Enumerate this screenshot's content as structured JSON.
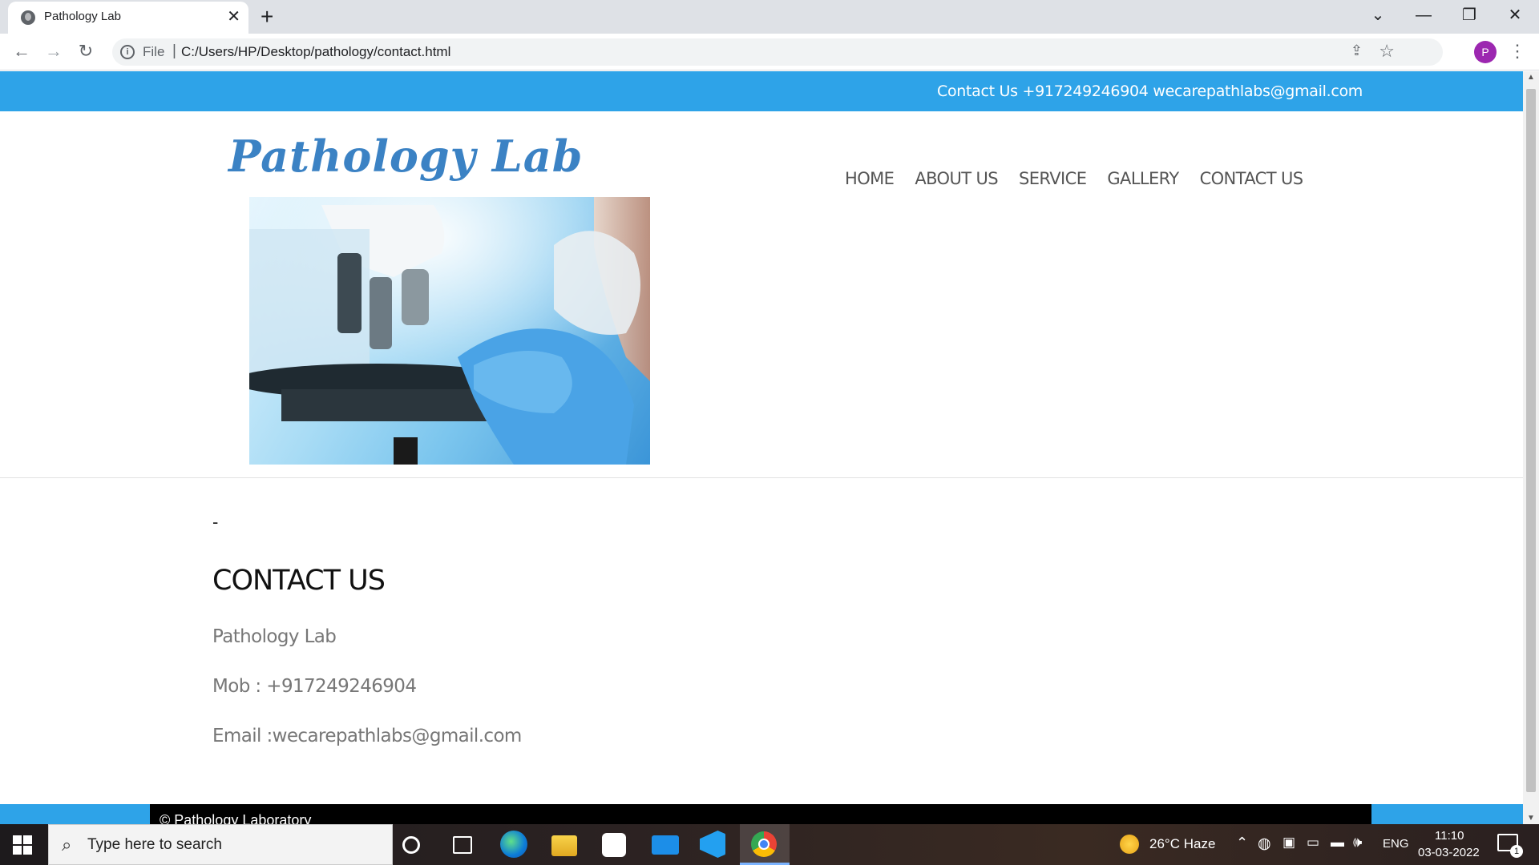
{
  "browser": {
    "tab_title": "Pathology Lab",
    "tab_close": "✕",
    "new_tab": "+",
    "window_controls": {
      "chevron": "⌄",
      "minimize": "—",
      "restore": "❐",
      "close": "✕"
    },
    "nav": {
      "back": "←",
      "forward": "→",
      "reload": "↻"
    },
    "omnibox": {
      "info": "i",
      "scheme_label": "File",
      "separator": "|",
      "url": "C:/Users/HP/Desktop/pathology/contact.html"
    },
    "share_icon": "⇪",
    "star_icon": "☆",
    "profile_initial": "P",
    "menu_icon": "⋮"
  },
  "page": {
    "topbar_text": "Contact Us +917249246904 wecarepathlabs@gmail.com",
    "logo": "Pathology Lab",
    "nav": [
      "HOME",
      "ABOUT US",
      "SERVICE",
      "GALLERY",
      "CONTACT US"
    ],
    "dash": "-",
    "heading": "CONTACT US",
    "lines": [
      "Pathology Lab",
      "Mob : +917249246904",
      "Email :wecarepathlabs@gmail.com"
    ],
    "footer": "© Pathology Laboratory"
  },
  "taskbar": {
    "search_placeholder": "Type here to search",
    "weather": "26°C  Haze",
    "language": "ENG",
    "time": "11:10",
    "date": "03-03-2022",
    "notification_count": "1"
  }
}
